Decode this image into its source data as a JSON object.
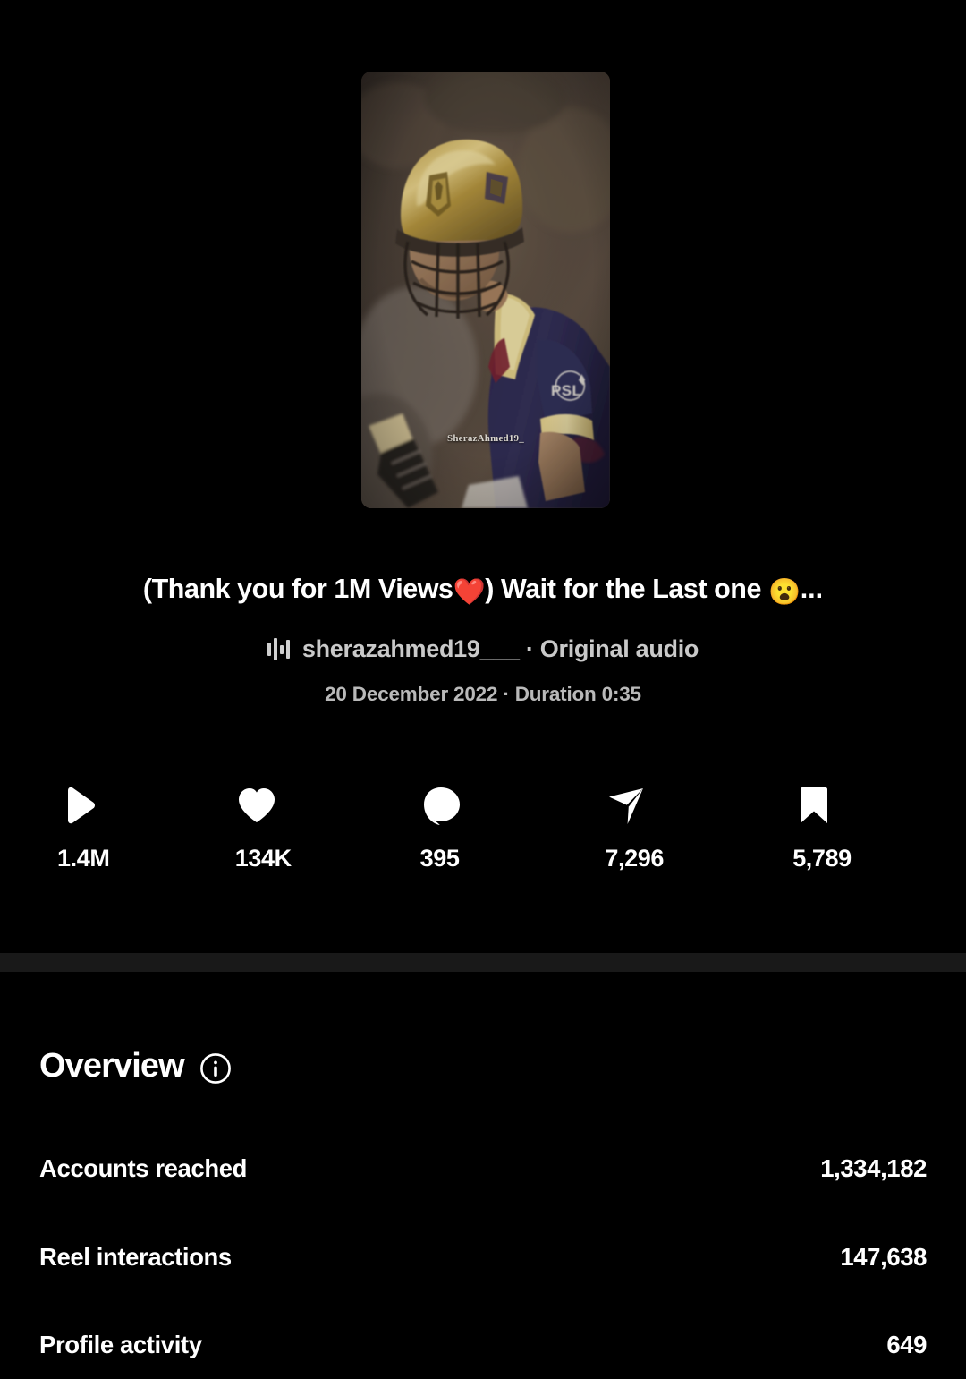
{
  "post": {
    "caption_part1": "(Thank you for 1M Views",
    "caption_heart": "❤️",
    "caption_part2": ") Wait for the Last one ",
    "caption_emoji": "😮",
    "caption_ellipsis": "...",
    "caption_full": "(Thank you for 1M Views❤️) Wait for the Last one 😮...",
    "audio_attribution": "sherazahmed19___ · Original audio",
    "audio_icon": "audio-waveform-icon",
    "meta_line": "20 December 2022 · Duration 0:35",
    "date": "20 December 2022",
    "duration": "Duration 0:35",
    "thumbnail_watermark": "SherazAhmed19_",
    "thumbnail_alt": "cricket-batsman-gold-helmet"
  },
  "metrics": [
    {
      "icon": "play-icon",
      "value": "1.4M",
      "name": "plays"
    },
    {
      "icon": "heart-icon",
      "value": "134K",
      "name": "likes"
    },
    {
      "icon": "comment-icon",
      "value": "395",
      "name": "comments"
    },
    {
      "icon": "share-icon",
      "value": "7,296",
      "name": "shares"
    },
    {
      "icon": "bookmark-icon",
      "value": "5,789",
      "name": "saves"
    }
  ],
  "overview": {
    "title": "Overview",
    "info_icon": "info-circle-icon",
    "rows": [
      {
        "label": "Accounts reached",
        "value": "1,334,182"
      },
      {
        "label": "Reel interactions",
        "value": "147,638"
      },
      {
        "label": "Profile activity",
        "value": "649"
      }
    ]
  },
  "colors": {
    "background": "#000000",
    "text_primary": "#ffffff",
    "text_secondary": "#c9c9c9",
    "divider": "#191919",
    "heart_red": "#ed2f3f"
  }
}
